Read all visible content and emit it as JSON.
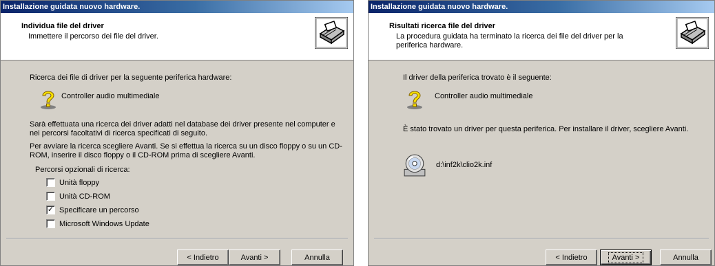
{
  "colors": {
    "title_start": "#0a246a",
    "title_end": "#a6caf0",
    "dialog_bg": "#d4d0c8",
    "header_bg": "#ffffff"
  },
  "dialog1": {
    "window_title": "Installazione guidata nuovo hardware.",
    "header_title": "Individua file del driver",
    "header_subtitle": "Immettere il percorso dei file del driver.",
    "intro": "Ricerca dei file di driver per la seguente periferica hardware:",
    "device_icon": "question-mark-icon",
    "device_name": "Controller audio multimediale",
    "paragraph1": "Sarà effettuata una ricerca dei driver adatti nel database dei driver presente nel computer e nei percorsi facoltativi di ricerca specificati di seguito.",
    "paragraph2": "Per avviare la ricerca scegliere Avanti. Se si effettua la ricerca su un disco floppy o su un CD-ROM, inserire il disco floppy o il CD-ROM prima di scegliere Avanti.",
    "options_label": "Percorsi opzionali di ricerca:",
    "options": [
      {
        "label": "Unità floppy",
        "checked": false
      },
      {
        "label": "Unità CD-ROM",
        "checked": false
      },
      {
        "label": "Specificare un percorso",
        "checked": true
      },
      {
        "label": "Microsoft Windows Update",
        "checked": false
      }
    ],
    "buttons": {
      "back": "< Indietro",
      "next": "Avanti >",
      "cancel": "Annulla"
    }
  },
  "dialog2": {
    "window_title": "Installazione guidata nuovo hardware.",
    "header_title": "Risultati ricerca file del driver",
    "header_subtitle": "La procedura guidata ha terminato la ricerca dei file del driver per la periferica hardware.",
    "intro": "Il driver della periferica trovato è il seguente:",
    "device_icon": "question-mark-icon",
    "device_name": "Controller audio multimediale",
    "found_text": "È stato trovato un driver per questa periferica. Per installare il driver, scegliere Avanti.",
    "file_icon": "cd-disc-icon",
    "driver_path": "d:\\inf2k\\clio2k.inf",
    "buttons": {
      "back": "< Indietro",
      "next": "Avanti >",
      "cancel": "Annulla"
    }
  }
}
